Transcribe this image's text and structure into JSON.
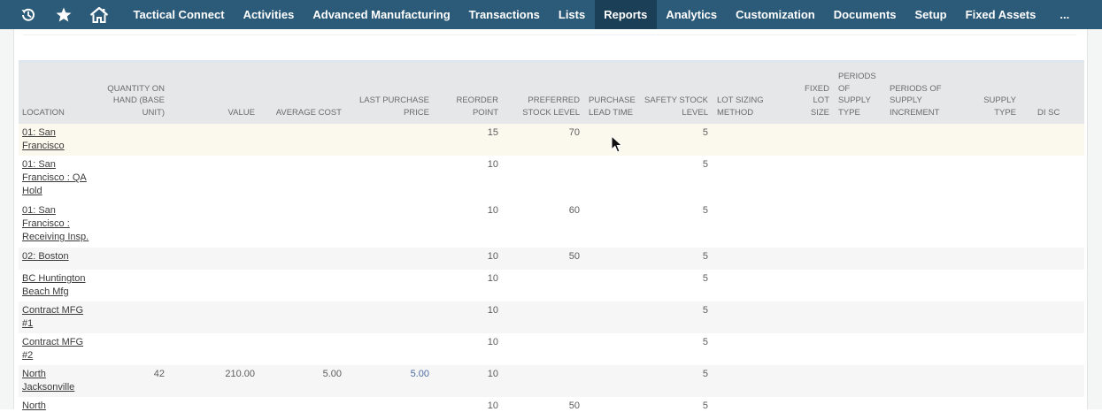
{
  "nav": {
    "items": [
      {
        "label": "Tactical Connect",
        "active": false
      },
      {
        "label": "Activities",
        "active": false
      },
      {
        "label": "Advanced Manufacturing",
        "active": false
      },
      {
        "label": "Transactions",
        "active": false
      },
      {
        "label": "Lists",
        "active": false
      },
      {
        "label": "Reports",
        "active": true
      },
      {
        "label": "Analytics",
        "active": false
      },
      {
        "label": "Customization",
        "active": false
      },
      {
        "label": "Documents",
        "active": false
      },
      {
        "label": "Setup",
        "active": false
      },
      {
        "label": "Fixed Assets",
        "active": false
      },
      {
        "label": "...",
        "active": false
      }
    ],
    "icons": [
      "history-icon",
      "star-icon",
      "home-icon"
    ]
  },
  "table": {
    "headers": [
      "Location",
      "Quantity on Hand (Base Unit)",
      "Value",
      "Average Cost",
      "Last Purchase Price",
      "Reorder Point",
      "Preferred Stock Level",
      "Purchase Lead Time",
      "Safety Stock Level",
      "Lot Sizing Method",
      "Fixed Lot Size",
      "Periods of Supply Type",
      "Periods of Supply Increment",
      "Supply Type",
      "Di Sc"
    ],
    "rows": [
      {
        "location": "01: San Francisco",
        "qty": "",
        "value": "",
        "avg_cost": "",
        "last_price": "",
        "reorder": "15",
        "preferred": "70",
        "lead": "",
        "safety": "5"
      },
      {
        "location": "01: San Francisco : QA Hold",
        "qty": "",
        "value": "",
        "avg_cost": "",
        "last_price": "",
        "reorder": "10",
        "preferred": "",
        "lead": "",
        "safety": "5"
      },
      {
        "location": "01: San Francisco : Receiving Insp.",
        "qty": "",
        "value": "",
        "avg_cost": "",
        "last_price": "",
        "reorder": "10",
        "preferred": "60",
        "lead": "",
        "safety": "5"
      },
      {
        "location": "02: Boston",
        "qty": "",
        "value": "",
        "avg_cost": "",
        "last_price": "",
        "reorder": "10",
        "preferred": "50",
        "lead": "",
        "safety": "5"
      },
      {
        "location": "BC Huntington Beach Mfg",
        "qty": "",
        "value": "",
        "avg_cost": "",
        "last_price": "",
        "reorder": "10",
        "preferred": "",
        "lead": "",
        "safety": "5"
      },
      {
        "location": "Contract MFG #1",
        "qty": "",
        "value": "",
        "avg_cost": "",
        "last_price": "",
        "reorder": "10",
        "preferred": "",
        "lead": "",
        "safety": "5"
      },
      {
        "location": "Contract MFG #2",
        "qty": "",
        "value": "",
        "avg_cost": "",
        "last_price": "",
        "reorder": "10",
        "preferred": "",
        "lead": "",
        "safety": "5"
      },
      {
        "location": "North Jacksonville",
        "qty": "42",
        "value": "210.00",
        "avg_cost": "5.00",
        "last_price": "5.00",
        "reorder": "10",
        "preferred": "",
        "lead": "",
        "safety": "5"
      },
      {
        "location": "North",
        "qty": "",
        "value": "",
        "avg_cost": "",
        "last_price": "",
        "reorder": "10",
        "preferred": "50",
        "lead": "",
        "safety": "5"
      }
    ]
  },
  "colors": {
    "nav_bg": "#2c5a79",
    "nav_active": "#1c3f58",
    "header_bg": "#e5e7e9",
    "highlight_row": "#fbf9ee",
    "link_blue": "#4c6da3"
  }
}
